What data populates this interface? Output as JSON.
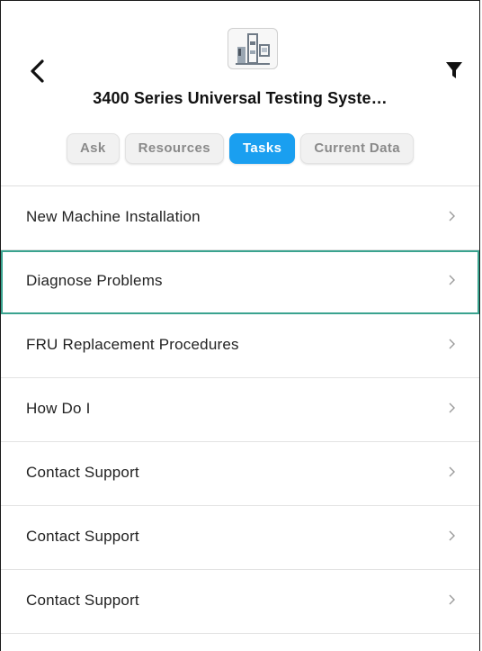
{
  "header": {
    "title": "3400 Series Universal Testing Syste…",
    "back_icon": "chevron-left-icon",
    "filter_icon": "filter-icon",
    "logo": "machine-logo-icon"
  },
  "tabs": [
    {
      "label": "Ask",
      "active": false
    },
    {
      "label": "Resources",
      "active": false
    },
    {
      "label": "Tasks",
      "active": true
    },
    {
      "label": "Current Data",
      "active": false
    }
  ],
  "items": [
    {
      "label": "New Machine Installation"
    },
    {
      "label": "Diagnose Problems",
      "selected": true
    },
    {
      "label": "FRU Replacement Procedures"
    },
    {
      "label": "How Do I"
    },
    {
      "label": "Contact Support"
    },
    {
      "label": "Contact Support"
    },
    {
      "label": "Contact Support"
    }
  ],
  "colors": {
    "accent": "#1a9ff0",
    "selection_border": "#3aa38f"
  }
}
